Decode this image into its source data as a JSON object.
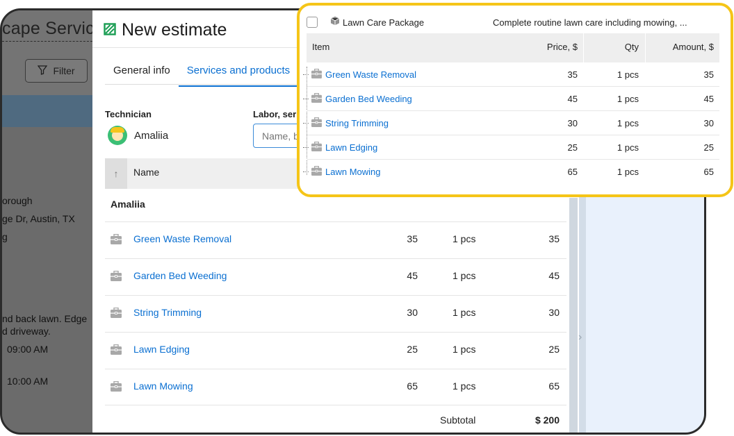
{
  "background": {
    "title": "cape Servic",
    "filter_label": "Filter",
    "lines": [
      "orough",
      "ge Dr, Austin, TX",
      "g",
      "nd back lawn. Edge",
      "d driveway.",
      "09:00 AM",
      "10:00 AM"
    ]
  },
  "modal": {
    "title": "New estimate",
    "tabs": [
      {
        "label": "General info",
        "active": false
      },
      {
        "label": "Services and products",
        "active": true
      }
    ],
    "technician_label": "Technician",
    "technician_name": "Amaliia",
    "labor_label": "Labor, ser",
    "labor_placeholder": "Name, b",
    "columns": {
      "name": "Name"
    },
    "group": "Amaliia",
    "rows": [
      {
        "name": "Green Waste Removal",
        "price": "35",
        "qty": "1 pcs",
        "amount": "35"
      },
      {
        "name": "Garden Bed Weeding",
        "price": "45",
        "qty": "1 pcs",
        "amount": "45"
      },
      {
        "name": "String Trimming",
        "price": "30",
        "qty": "1 pcs",
        "amount": "30"
      },
      {
        "name": "Lawn Edging",
        "price": "25",
        "qty": "1 pcs",
        "amount": "25"
      },
      {
        "name": "Lawn Mowing",
        "price": "65",
        "qty": "1 pcs",
        "amount": "65"
      }
    ],
    "subtotal_label": "Subtotal",
    "subtotal_value": "$ 200"
  },
  "package": {
    "name": "Lawn Care Package",
    "description": "Complete routine lawn care including mowing, ...",
    "columns": {
      "item": "Item",
      "price": "Price, $",
      "qty": "Qty",
      "amount": "Amount, $"
    },
    "rows": [
      {
        "name": "Green Waste Removal",
        "price": "35",
        "qty": "1 pcs",
        "amount": "35"
      },
      {
        "name": "Garden Bed Weeding",
        "price": "45",
        "qty": "1 pcs",
        "amount": "45"
      },
      {
        "name": "String Trimming",
        "price": "30",
        "qty": "1 pcs",
        "amount": "30"
      },
      {
        "name": "Lawn Edging",
        "price": "25",
        "qty": "1 pcs",
        "amount": "25"
      },
      {
        "name": "Lawn Mowing",
        "price": "65",
        "qty": "1 pcs",
        "amount": "65"
      }
    ]
  },
  "colors": {
    "accent": "#0a6fd1",
    "highlight": "#f5c518",
    "brand_green": "#1a9d53"
  },
  "icons": {
    "title": "estimate-icon",
    "row": "toolbox-icon",
    "package": "box-icon",
    "filter": "filter-icon",
    "sort": "arrow-up-icon",
    "panel": "chevron-right-icon"
  }
}
